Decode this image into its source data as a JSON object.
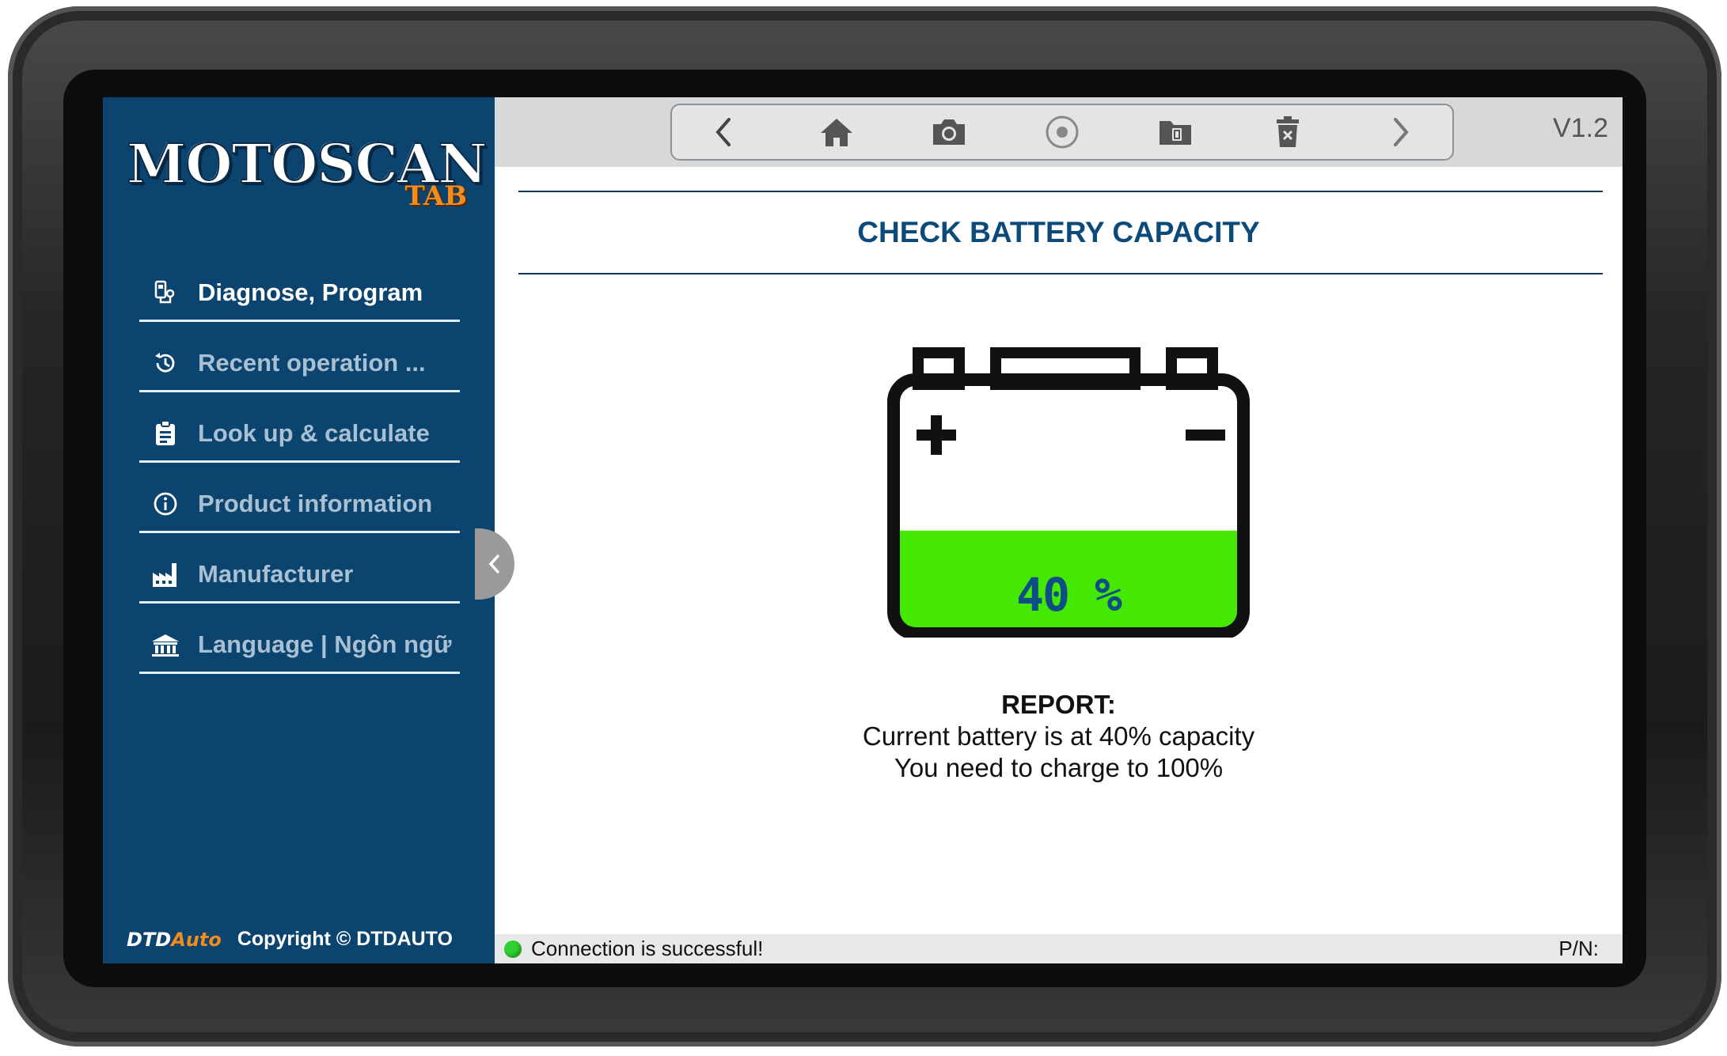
{
  "app": {
    "logo_main": "MOTOSCAN",
    "logo_sub": "TAB",
    "version": "V1.2"
  },
  "sidebar": {
    "items": [
      {
        "label": "Diagnose, Program",
        "icon": "diagnose-icon",
        "active": true
      },
      {
        "label": "Recent operation ...",
        "icon": "history-icon",
        "active": false
      },
      {
        "label": "Look up & calculate",
        "icon": "clipboard-icon",
        "active": false
      },
      {
        "label": "Product information",
        "icon": "info-icon",
        "active": false
      },
      {
        "label": "Manufacturer",
        "icon": "factory-icon",
        "active": false
      },
      {
        "label": "Language | Ngôn ngữ",
        "icon": "building-icon",
        "active": false
      }
    ],
    "footer_brand": "DTDAuto",
    "copyright": "Copyright © DTDAUTO"
  },
  "toolbar": {
    "buttons": [
      "back-icon",
      "home-icon",
      "camera-icon",
      "record-icon",
      "folder-icon",
      "delete-icon",
      "forward-icon"
    ]
  },
  "main": {
    "title": "CHECK BATTERY CAPACITY",
    "battery": {
      "level_percent": 40,
      "label": "40 %",
      "fill_color": "#44e800"
    },
    "report": {
      "title": "REPORT:",
      "line1": "Current battery is at 40% capacity",
      "line2": "You need to charge to 100%"
    }
  },
  "status": {
    "connection": "Connection is successful!",
    "indicator_color": "#2ed12e",
    "pn_label": "P/N:"
  },
  "colors": {
    "sidebar_bg": "#0c4470",
    "accent": "#0c4a7a",
    "logo_accent": "#f28c1c"
  }
}
